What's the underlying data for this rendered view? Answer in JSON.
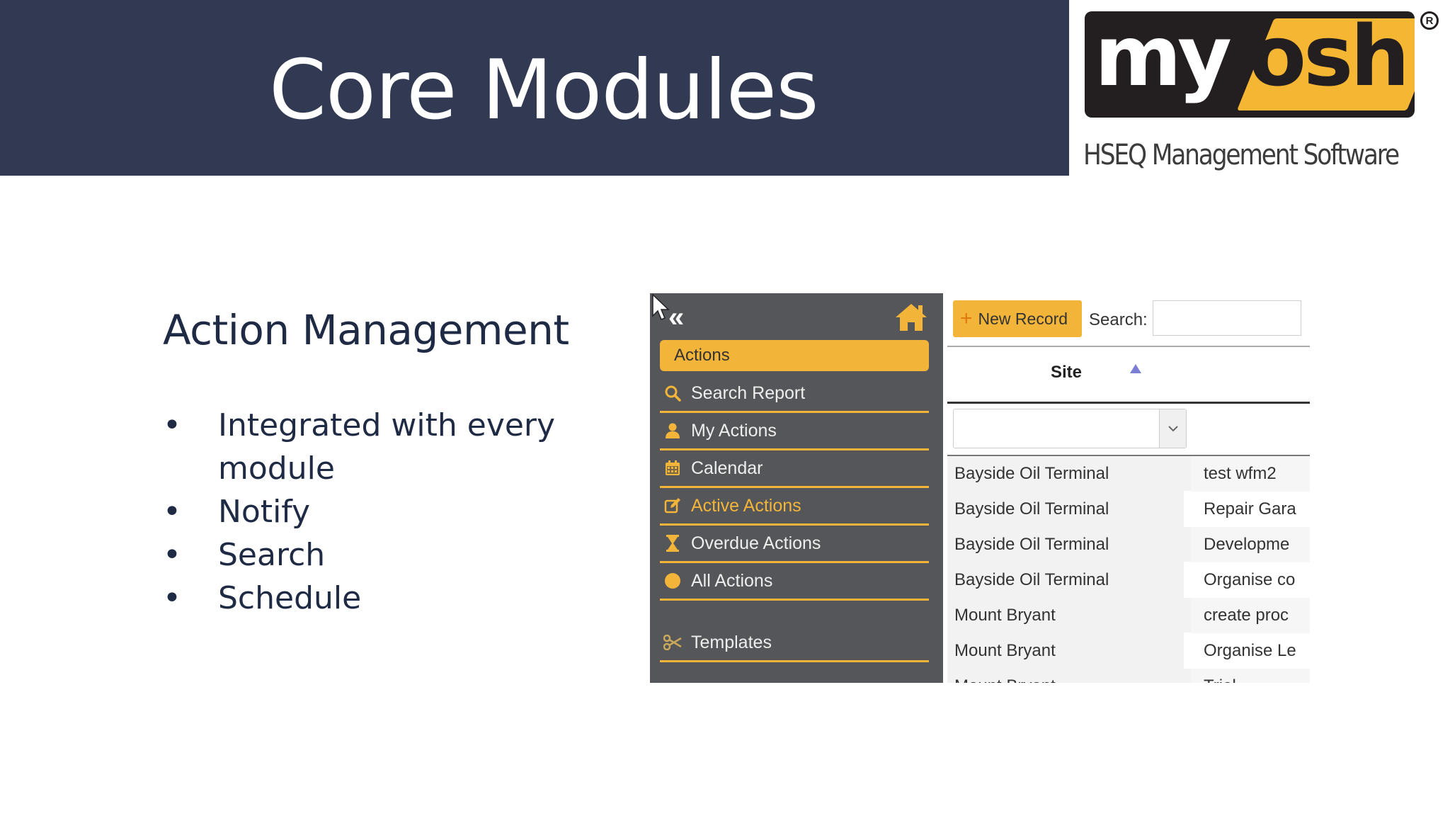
{
  "header": {
    "title": "Core Modules",
    "bg_color": "#323a53"
  },
  "logo": {
    "part1": "my",
    "part2": "osh",
    "registered": "R",
    "tagline": "HSEQ Management Software",
    "accent_color": "#f5b633"
  },
  "section": {
    "title": "Action Management",
    "bullets": [
      "Integrated with every module",
      "Notify",
      "Search",
      "Schedule"
    ]
  },
  "app": {
    "sidebar": {
      "collapse_glyph": "«",
      "header_label": "Actions",
      "items": [
        {
          "label": "Search Report",
          "icon": "search-icon",
          "active": false
        },
        {
          "label": "My Actions",
          "icon": "user-icon",
          "active": false
        },
        {
          "label": "Calendar",
          "icon": "calendar-icon",
          "active": false
        },
        {
          "label": "Active Actions",
          "icon": "edit-icon",
          "active": true
        },
        {
          "label": "Overdue Actions",
          "icon": "hourglass-icon",
          "active": false
        },
        {
          "label": "All Actions",
          "icon": "circle-icon",
          "active": false
        },
        {
          "label": "Templates",
          "icon": "scissors-icon",
          "active": false
        }
      ],
      "accent_color": "#f3b539"
    },
    "toolbar": {
      "new_record_label": "New Record",
      "plus_glyph": "+",
      "search_label": "Search:",
      "search_value": ""
    },
    "table": {
      "columns": [
        "Site"
      ],
      "filter_value": "",
      "rows": [
        {
          "site": "Bayside Oil Terminal",
          "desc": "test wfm2"
        },
        {
          "site": "Bayside Oil Terminal",
          "desc": "Repair Gara"
        },
        {
          "site": "Bayside Oil Terminal",
          "desc": "Developme"
        },
        {
          "site": "Bayside Oil Terminal",
          "desc": "Organise co"
        },
        {
          "site": "Mount Bryant",
          "desc": "create proc"
        },
        {
          "site": "Mount Bryant",
          "desc": "Organise Le"
        },
        {
          "site": "Mount Bryant",
          "desc": "Trial"
        }
      ]
    }
  }
}
